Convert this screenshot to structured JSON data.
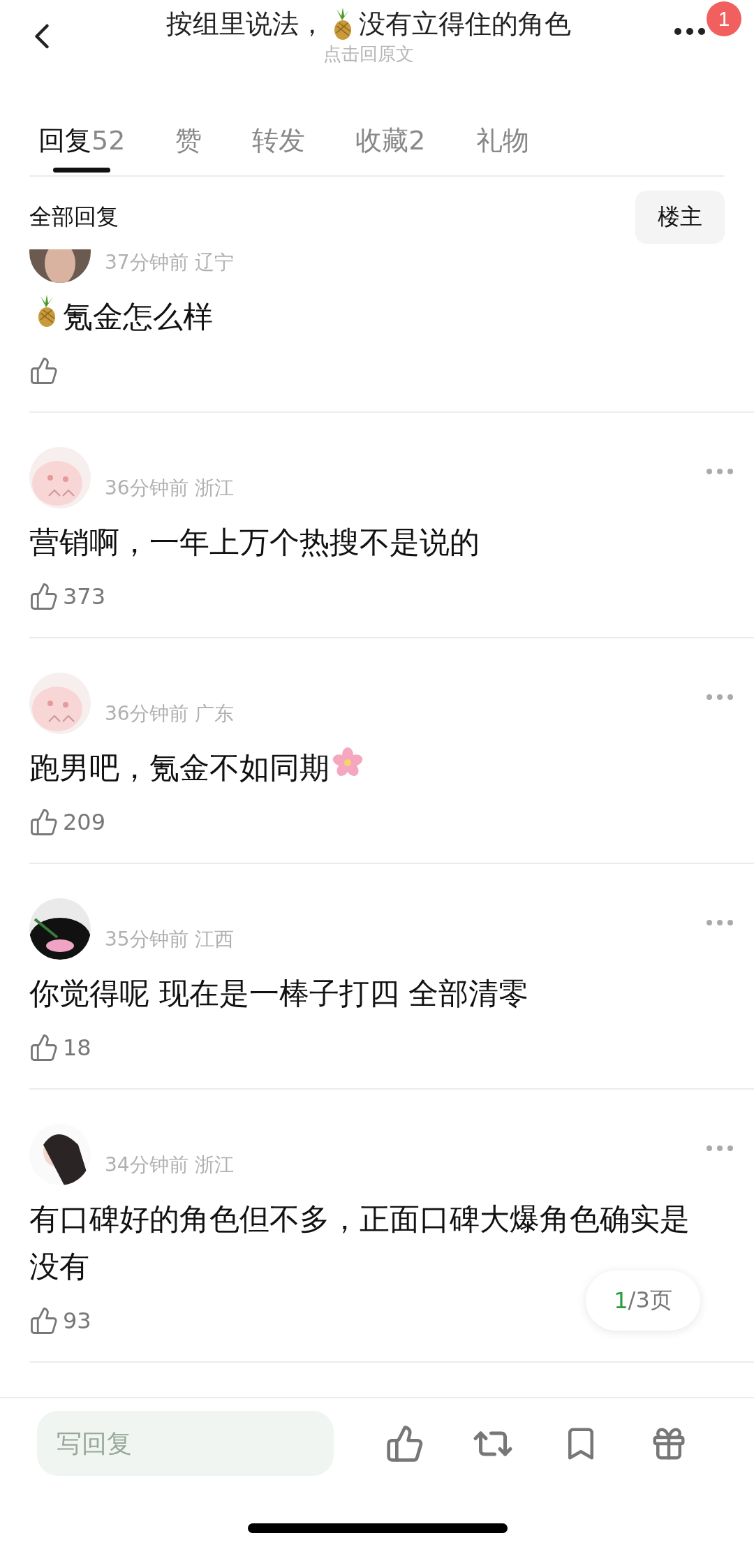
{
  "header": {
    "title": [
      {
        "kind": "text",
        "text": "按组里说法，"
      },
      {
        "kind": "pineapple"
      },
      {
        "kind": "text",
        "text": "没有立得住的角色"
      }
    ],
    "subtitle": "点击回原文",
    "badge": "1"
  },
  "tabs": [
    {
      "label": "回复",
      "count": "52",
      "selected": true
    },
    {
      "label": "赞",
      "selected": false
    },
    {
      "label": "转发",
      "selected": false
    },
    {
      "label": "收藏",
      "count": "2",
      "selected": false
    },
    {
      "label": "礼物",
      "selected": false
    }
  ],
  "section": {
    "title": "全部回复",
    "filter": "楼主"
  },
  "comments": [
    {
      "cut": true,
      "menu": false,
      "time": "37分钟前",
      "place": "辽宁",
      "text": [
        {
          "kind": "pineapple"
        },
        {
          "kind": "text",
          "text": "氪金怎么样"
        }
      ]
    },
    {
      "cut": false,
      "menu": true,
      "time": "36分钟前",
      "place": "浙江",
      "text": [
        {
          "kind": "text",
          "text": "营销啊，一年上万个热搜不是说的"
        }
      ],
      "likes": "373"
    },
    {
      "cut": false,
      "menu": true,
      "time": "36分钟前",
      "place": "广东",
      "text": [
        {
          "kind": "text",
          "text": "跑男吧，氪金不如同期"
        },
        {
          "kind": "flower"
        }
      ],
      "likes": "209"
    },
    {
      "cut": false,
      "menu": true,
      "time": "35分钟前",
      "place": "江西",
      "text": [
        {
          "kind": "text",
          "text": "你觉得呢 现在是一棒子打四 全部清零"
        }
      ],
      "likes": "18"
    },
    {
      "cut": false,
      "menu": true,
      "time": "34分钟前",
      "place": "浙江",
      "text": [
        {
          "kind": "text",
          "text": "有口碑好的角色但不多，正面口碑大爆角色确实是没有"
        }
      ],
      "likes": "93"
    }
  ],
  "pager": {
    "current": "1",
    "rest": "/3页"
  },
  "reply": {
    "placeholder": "写回复"
  }
}
